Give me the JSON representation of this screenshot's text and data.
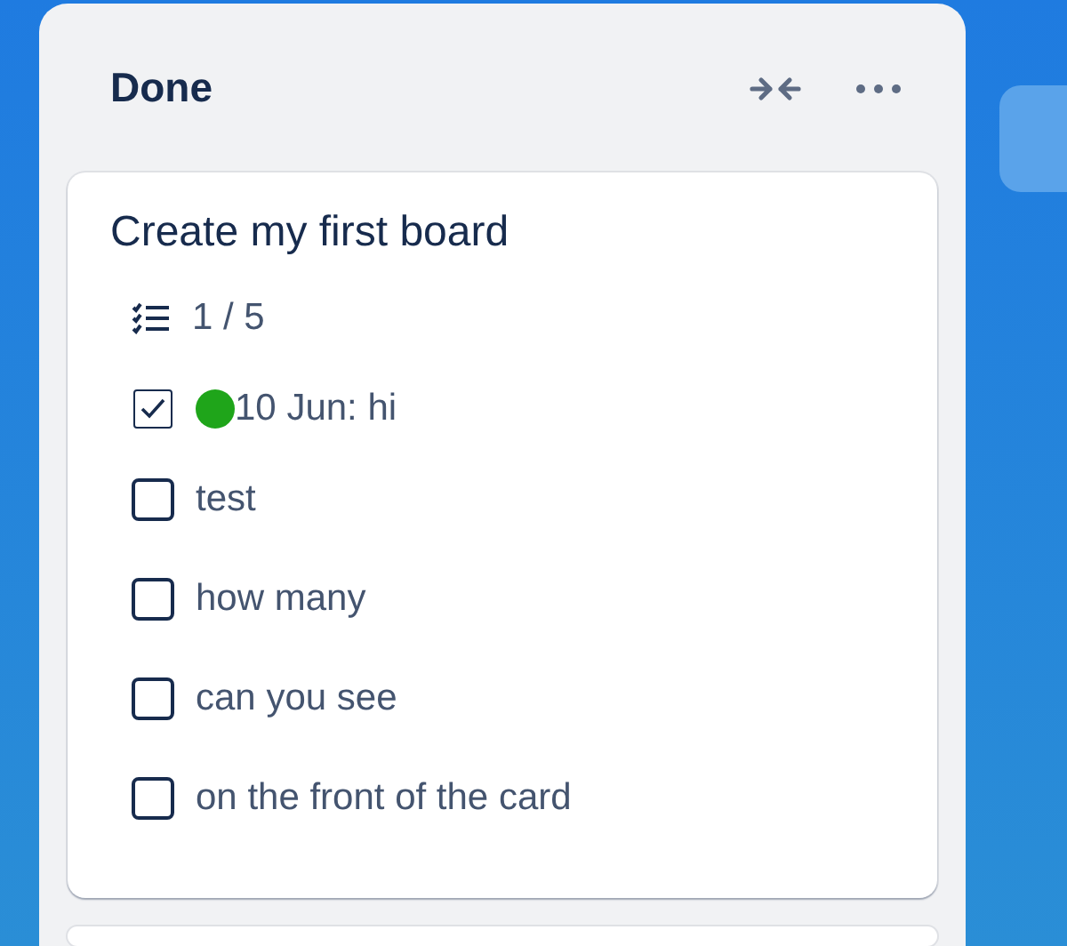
{
  "list": {
    "title": "Done"
  },
  "card": {
    "title": "Create my first board",
    "badge": "1 / 5",
    "checklist": [
      {
        "text": "10 Jun: hi",
        "checked": true,
        "color": "#1fa51a"
      },
      {
        "text": "test",
        "checked": false
      },
      {
        "text": "how many",
        "checked": false
      },
      {
        "text": "can you see",
        "checked": false
      },
      {
        "text": "on the front of the card",
        "checked": false
      }
    ]
  }
}
